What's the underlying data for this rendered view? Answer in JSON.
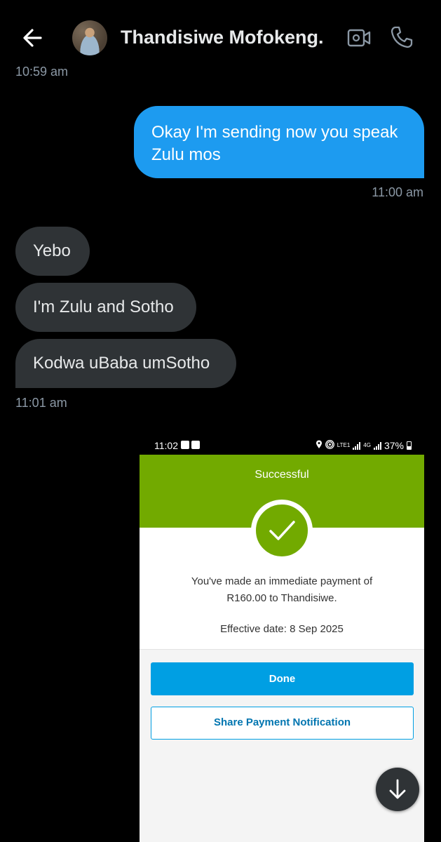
{
  "header": {
    "contact_name": "Thandisiwe Mofokeng.",
    "icons": [
      "back-arrow-icon",
      "video-call-icon",
      "phone-icon"
    ]
  },
  "messages": [
    {
      "direction": "incoming",
      "time": "10:59 am"
    },
    {
      "direction": "outgoing",
      "text": "Okay I'm sending now you speak Zulu mos",
      "time": "11:00 am"
    },
    {
      "direction": "incoming",
      "text": "Yebo"
    },
    {
      "direction": "incoming",
      "text": "I'm Zulu and Sotho"
    },
    {
      "direction": "incoming",
      "text": "Kodwa uBaba umSotho",
      "time": "11:01 am"
    }
  ],
  "attachment": {
    "status_bar": {
      "time": "11:02",
      "network_label": "LTE1",
      "network_type": "4G",
      "battery": "37%"
    },
    "status_title": "Successful",
    "payment_message": "You've made an immediate payment of R160.00 to Thandisiwe.",
    "effective_date": "Effective date: 8 Sep 2025",
    "done_label": "Done",
    "share_label": "Share Payment Notification"
  },
  "colors": {
    "outgoing_bubble": "#1d9bf0",
    "incoming_bubble": "#2f3336",
    "success_green": "#72aa00",
    "primary_blue": "#009fe3"
  }
}
